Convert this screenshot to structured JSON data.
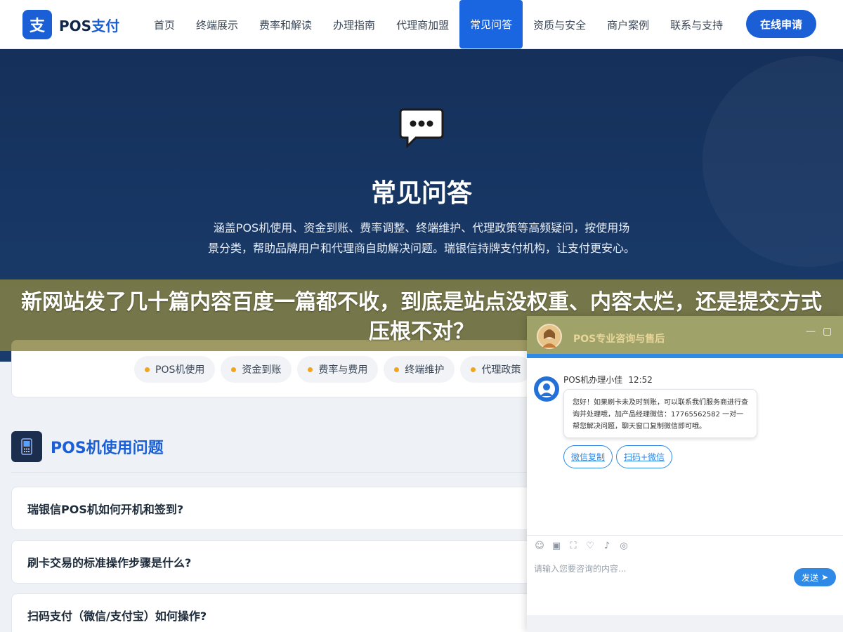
{
  "header": {
    "logo_badge": "支",
    "logo_prefix": "POS",
    "logo_brand": "支付",
    "nav": [
      {
        "label": "首页"
      },
      {
        "label": "终端展示"
      },
      {
        "label": "费率和解读"
      },
      {
        "label": "办理指南"
      },
      {
        "label": "代理商加盟"
      },
      {
        "label": "常见问答",
        "active": true
      },
      {
        "label": "资质与安全"
      },
      {
        "label": "商户案例"
      },
      {
        "label": "联系与支持"
      }
    ],
    "cta_label": "在线申请"
  },
  "hero": {
    "icon": "speech-bubble-icon",
    "title": "常见问答",
    "description": "涵盖POS机使用、资金到账、费率调整、终端维护、代理政策等高频疑问，按使用场景分类，帮助品牌用户和代理商自助解决问题。瑞银信持牌支付机构，让支付更安心。"
  },
  "overlay": {
    "headline": "新网站发了几十篇内容百度一篇都不收，到底是站点没权重、内容太烂，还是提交方式压根不对？"
  },
  "categories": [
    {
      "label": "POS机使用"
    },
    {
      "label": "资金到账"
    },
    {
      "label": "费率与费用"
    },
    {
      "label": "终端维护"
    },
    {
      "label": "代理政策"
    }
  ],
  "section": {
    "icon": "pos-terminal-icon",
    "title": "POS机使用问题",
    "questions": [
      {
        "text": "瑞银信POS机如何开机和签到?"
      },
      {
        "text": "刷卡交易的标准操作步骤是什么?"
      },
      {
        "text": "扫码支付（微信/支付宝）如何操作?"
      }
    ]
  },
  "chat": {
    "title": "POS专业咨询与售后",
    "minimize_symbol": "—",
    "maximize_symbol": "▢",
    "agent_name": "POS机办理小佳",
    "time": "12:52",
    "message": "您好！如果刷卡未及时到账，可以联系我们服务商进行查询并处理哦，加产品经理微信：17765562582 一对一帮您解决问题，聊天窗口复制微信即可哦。",
    "buttons": [
      {
        "label": "微信复制"
      },
      {
        "label": "扫码+微信"
      }
    ],
    "tools": [
      "emoji-icon",
      "image-icon",
      "screenshot-icon",
      "rating-icon",
      "voice-icon",
      "wechat-icon"
    ],
    "input_placeholder": "请输入您要咨询的内容...",
    "send_label": "发送"
  },
  "colors": {
    "primary": "#1a5fd6",
    "hero_bg": "#15305a",
    "accent_dot": "#f0a51a",
    "chat_blue": "#2e8ae6"
  }
}
